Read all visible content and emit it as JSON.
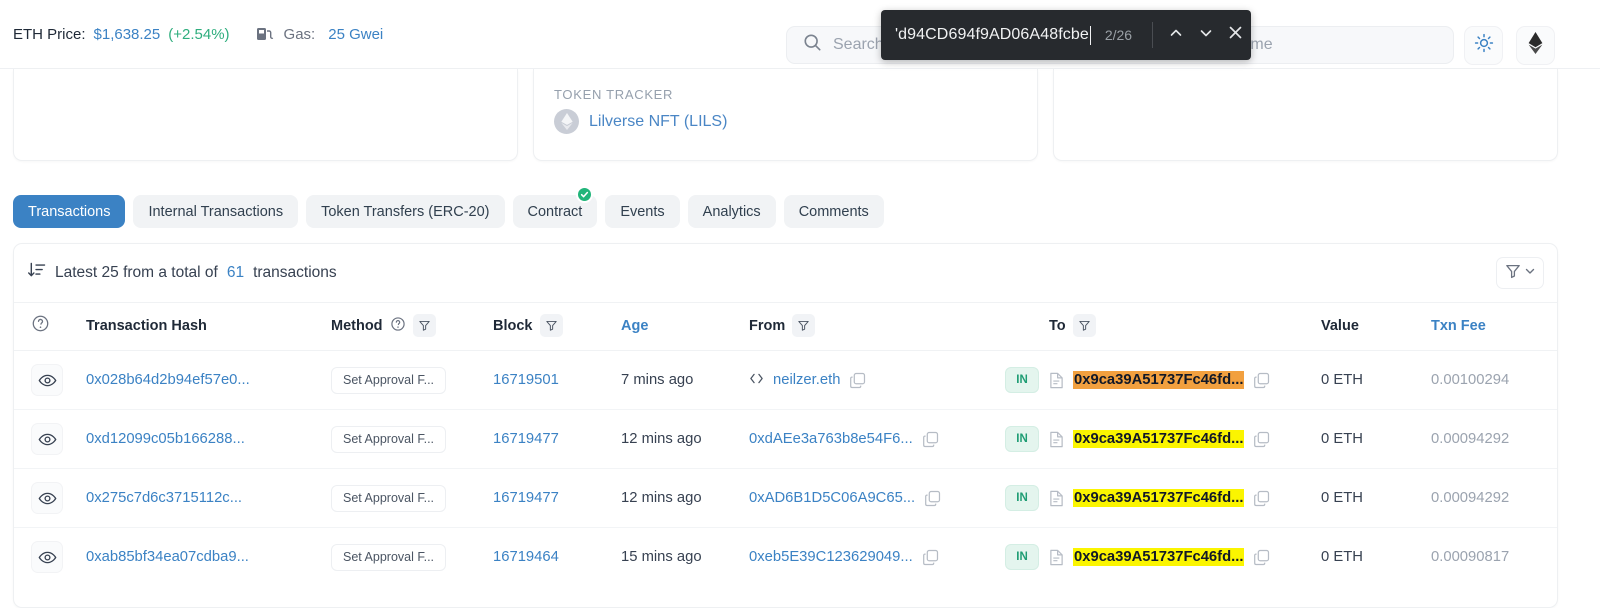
{
  "topbar": {
    "eth_price_label": "ETH Price:",
    "eth_price_value": "$1,638.25",
    "eth_price_change": "(+2.54%)",
    "gas_icon": "gas-pump-icon",
    "gas_label": "Gas:",
    "gas_value": "25 Gwei",
    "search_placeholder": "Search by Address / Txn Hash / Block / Token / Domain Name",
    "search_icon": "search-icon",
    "theme_toggle_icon": "sun-icon",
    "network_icon": "ethereum-diamond-icon"
  },
  "find_bar": {
    "query": "'d94CD694f9AD06A48fcbe",
    "count": "2/26",
    "prev_icon": "chevron-up-icon",
    "next_icon": "chevron-down-icon",
    "close_icon": "close-icon"
  },
  "token_tracker": {
    "label": "TOKEN TRACKER",
    "token_icon": "token-placeholder-icon",
    "token_name": "Lilverse NFT (LILS)"
  },
  "tabs": [
    {
      "label": "Transactions",
      "active": true,
      "badge": false
    },
    {
      "label": "Internal Transactions",
      "active": false,
      "badge": false
    },
    {
      "label": "Token Transfers (ERC-20)",
      "active": false,
      "badge": false
    },
    {
      "label": "Contract",
      "active": false,
      "badge": true,
      "badge_icon": "verified-check-icon"
    },
    {
      "label": "Events",
      "active": false,
      "badge": false
    },
    {
      "label": "Analytics",
      "active": false,
      "badge": false
    },
    {
      "label": "Comments",
      "active": false,
      "badge": false
    }
  ],
  "panel": {
    "sort_icon": "sort-descending-icon",
    "latest_prefix": "Latest 25 from a total of",
    "latest_count": "61",
    "latest_suffix": "transactions",
    "filter_icon": "funnel-icon",
    "filter_chevron_icon": "chevron-down-icon"
  },
  "table": {
    "headers": {
      "help": "help-circle-icon",
      "hash": "Transaction Hash",
      "method": "Method",
      "method_help": "help-circle-icon",
      "block": "Block",
      "age": "Age",
      "from": "From",
      "to": "To",
      "value": "Value",
      "fee": "Txn Fee",
      "filter_icon": "funnel-icon"
    },
    "rows": [
      {
        "eye_icon": "eye-icon",
        "hash": "0x028b64d2b94ef57e0...",
        "method": "Set Approval F...",
        "block": "16719501",
        "age": "7 mins ago",
        "from": "neilzer.eth",
        "from_prefix_icon": "code-brackets-icon",
        "from_copy_icon": "copy-icon",
        "direction": "IN",
        "to_doc_icon": "contract-document-icon",
        "to": "0x9ca39A51737Fc46fd...",
        "to_highlight": "active",
        "to_copy_icon": "copy-icon",
        "value": "0 ETH",
        "fee": "0.00100294"
      },
      {
        "eye_icon": "eye-icon",
        "hash": "0xd12099c05b166288...",
        "method": "Set Approval F...",
        "block": "16719477",
        "age": "12 mins ago",
        "from": "0xdAEe3a763b8e54F6...",
        "from_prefix_icon": "",
        "from_copy_icon": "copy-icon",
        "direction": "IN",
        "to_doc_icon": "contract-document-icon",
        "to": "0x9ca39A51737Fc46fd...",
        "to_highlight": "normal",
        "to_copy_icon": "copy-icon",
        "value": "0 ETH",
        "fee": "0.00094292"
      },
      {
        "eye_icon": "eye-icon",
        "hash": "0x275c7d6c3715112c...",
        "method": "Set Approval F...",
        "block": "16719477",
        "age": "12 mins ago",
        "from": "0xAD6B1D5C06A9C65...",
        "from_prefix_icon": "",
        "from_copy_icon": "copy-icon",
        "direction": "IN",
        "to_doc_icon": "contract-document-icon",
        "to": "0x9ca39A51737Fc46fd...",
        "to_highlight": "normal",
        "to_copy_icon": "copy-icon",
        "value": "0 ETH",
        "fee": "0.00094292"
      },
      {
        "eye_icon": "eye-icon",
        "hash": "0xab85bf34ea07cdba9...",
        "method": "Set Approval F...",
        "block": "16719464",
        "age": "15 mins ago",
        "from": "0xeb5E39C123629049...",
        "from_prefix_icon": "",
        "from_copy_icon": "copy-icon",
        "direction": "IN",
        "to_doc_icon": "contract-document-icon",
        "to": "0x9ca39A51737Fc46fd...",
        "to_highlight": "normal",
        "to_copy_icon": "copy-icon",
        "value": "0 ETH",
        "fee": "0.00090817"
      }
    ]
  },
  "colors": {
    "accent": "#3b82c4",
    "positive": "#2fae7e",
    "highlight_active": "#f2a03f",
    "highlight_normal": "#fbf500",
    "in_badge": "#1f9d74"
  }
}
